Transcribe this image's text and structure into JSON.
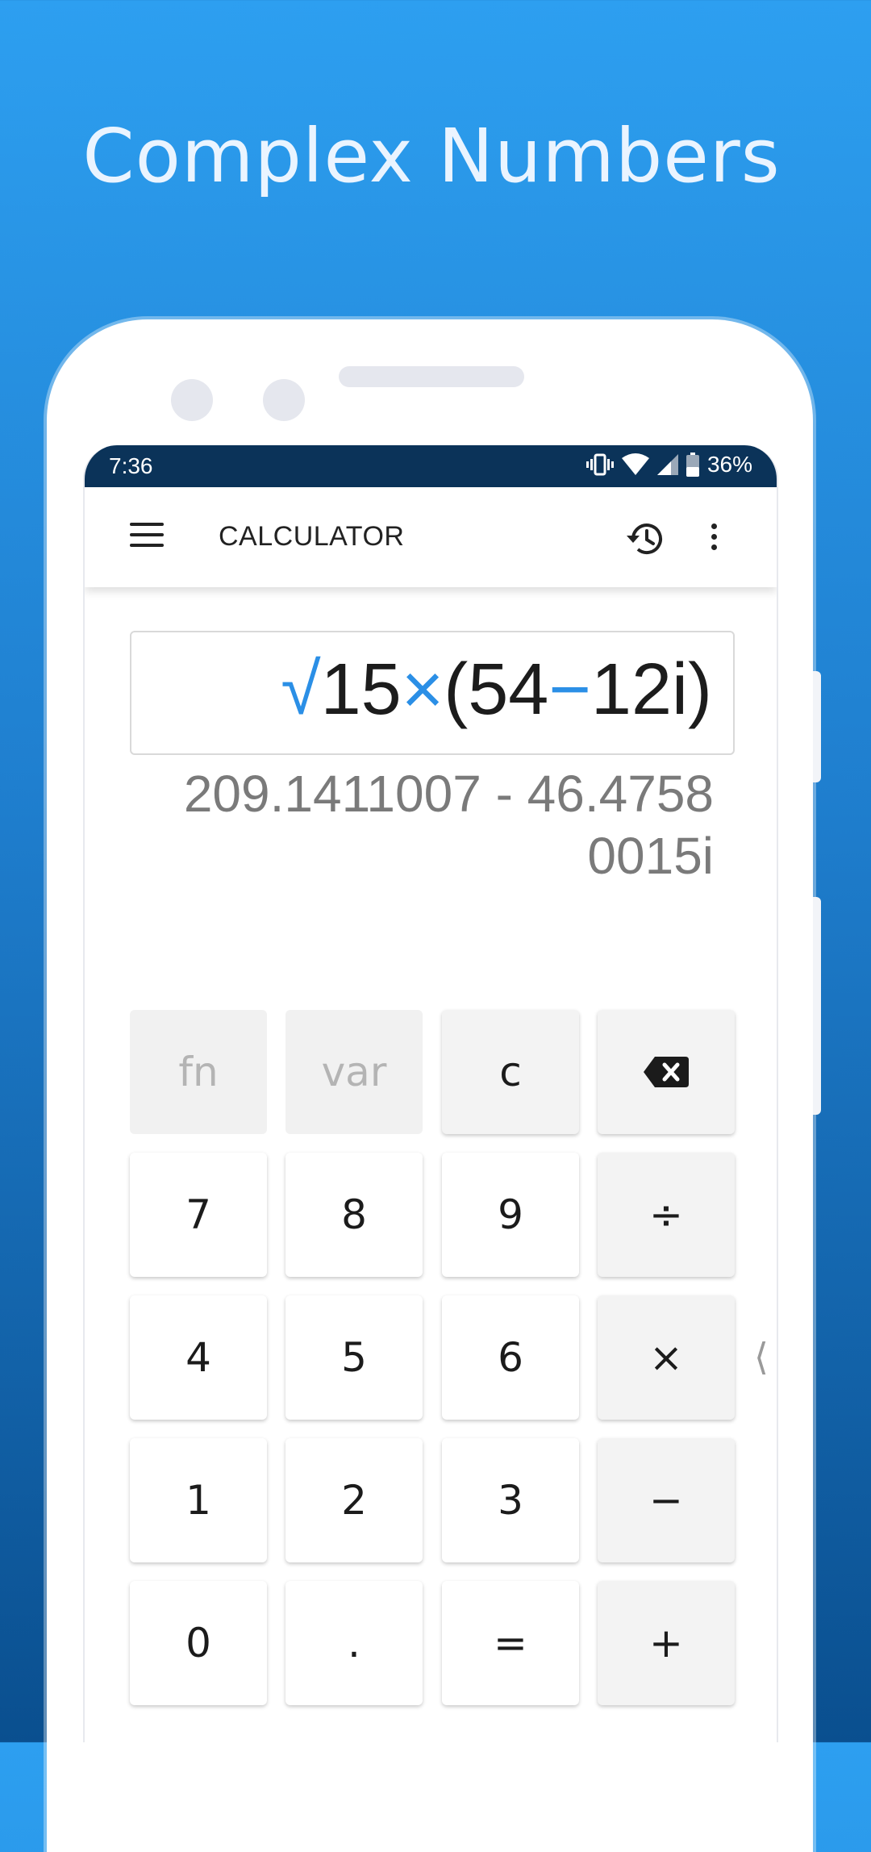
{
  "promo": {
    "title": "Complex Numbers"
  },
  "status_bar": {
    "time": "7:36",
    "battery": "36%"
  },
  "app_bar": {
    "title": "CALCULATOR",
    "icons": [
      "menu-icon",
      "history-icon",
      "more-vert-icon"
    ]
  },
  "display": {
    "expression": {
      "sqrt": "√",
      "n1": "15",
      "times": "×",
      "group_open": "(54",
      "minus": "−",
      "group_close": "12i)"
    },
    "result_line1": "209.1411007 - 46.4758",
    "result_line2": "0015i"
  },
  "keypad": {
    "fn": "fn",
    "var": "var",
    "clear": "c",
    "k7": "7",
    "k8": "8",
    "k9": "9",
    "divide": "÷",
    "k4": "4",
    "k5": "5",
    "k6": "6",
    "multiply": "×",
    "k1": "1",
    "k2": "2",
    "k3": "3",
    "subtract": "−",
    "k0": "0",
    "dot": ".",
    "equals": "=",
    "add": "+"
  },
  "drawer_handle": "⟨",
  "colors": {
    "accent": "#2b8fe6",
    "status_bar": "#0b3359",
    "background_top": "#2d9ff0",
    "background_bottom": "#0a4f8f"
  }
}
